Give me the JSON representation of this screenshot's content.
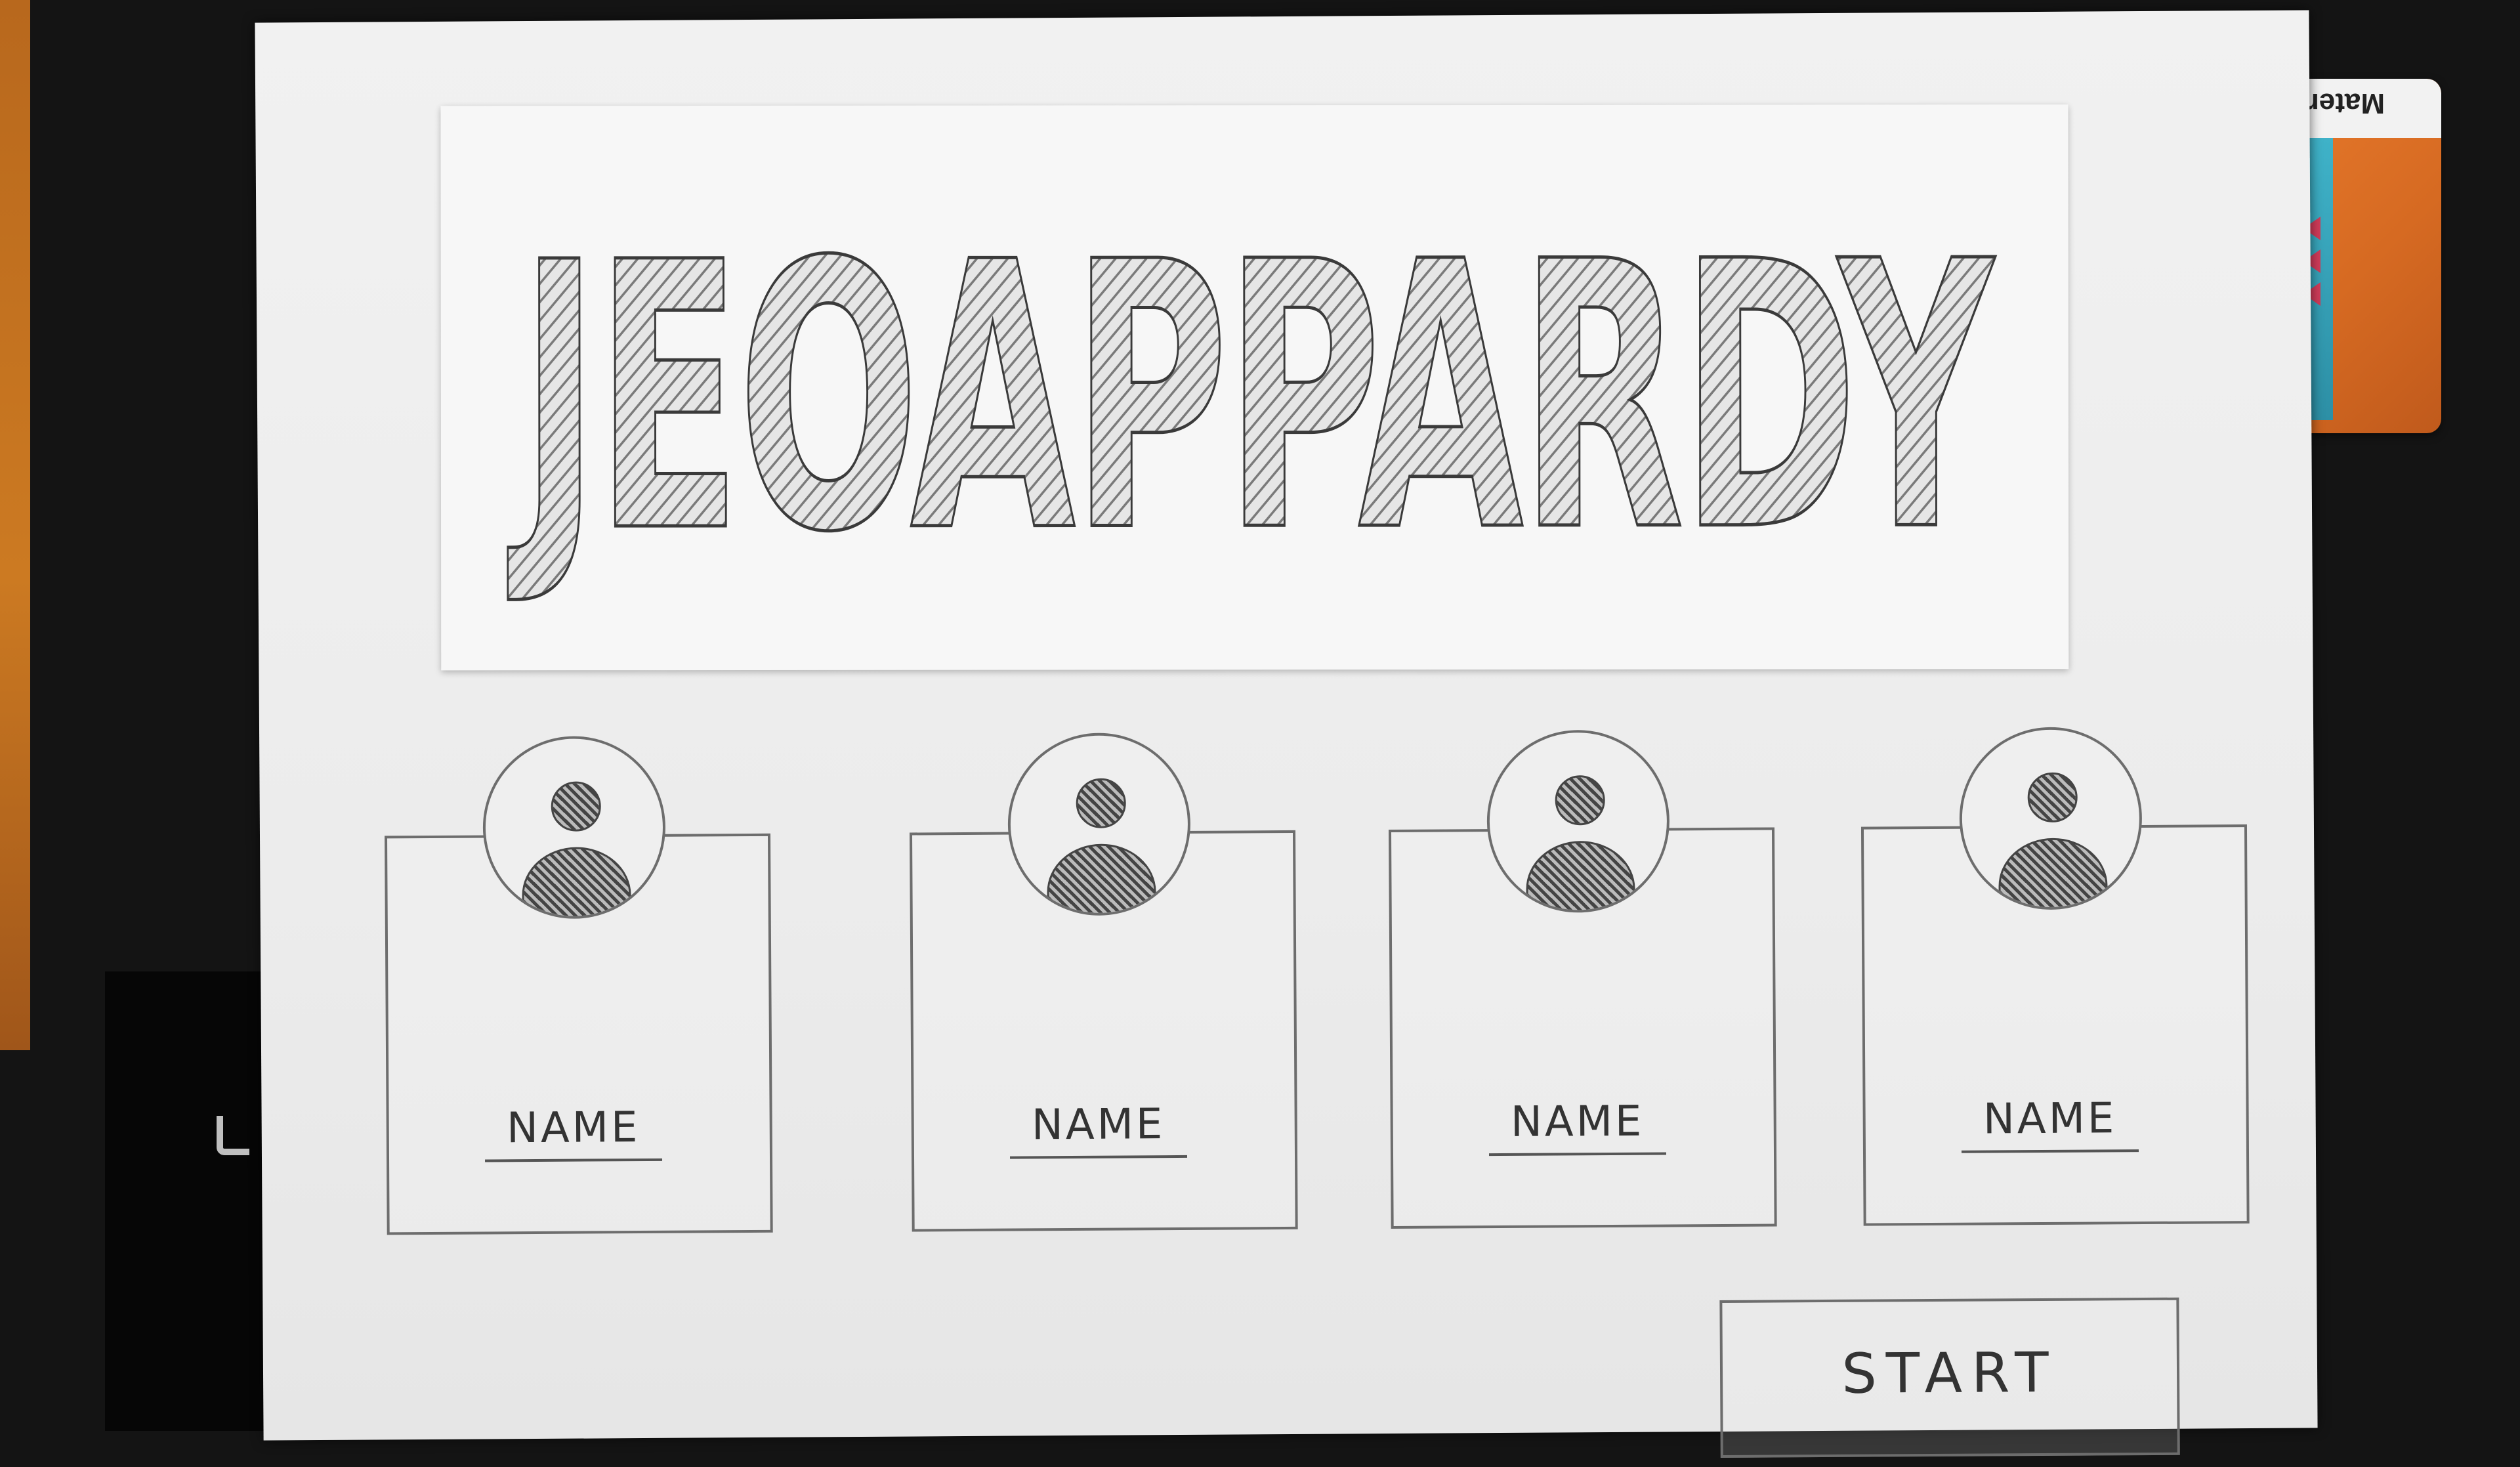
{
  "title": "JEOAPPARDY",
  "players": [
    {
      "name": "NAME"
    },
    {
      "name": "NAME"
    },
    {
      "name": "NAME"
    },
    {
      "name": "NAME"
    }
  ],
  "start_button": "START",
  "notebook_label": "Materia",
  "colors": {
    "paper": "#ececec",
    "pencil": "#444444",
    "notebook_orange": "#e87a2c",
    "notebook_teal": "#3fb2c8",
    "desk": "#141414"
  }
}
